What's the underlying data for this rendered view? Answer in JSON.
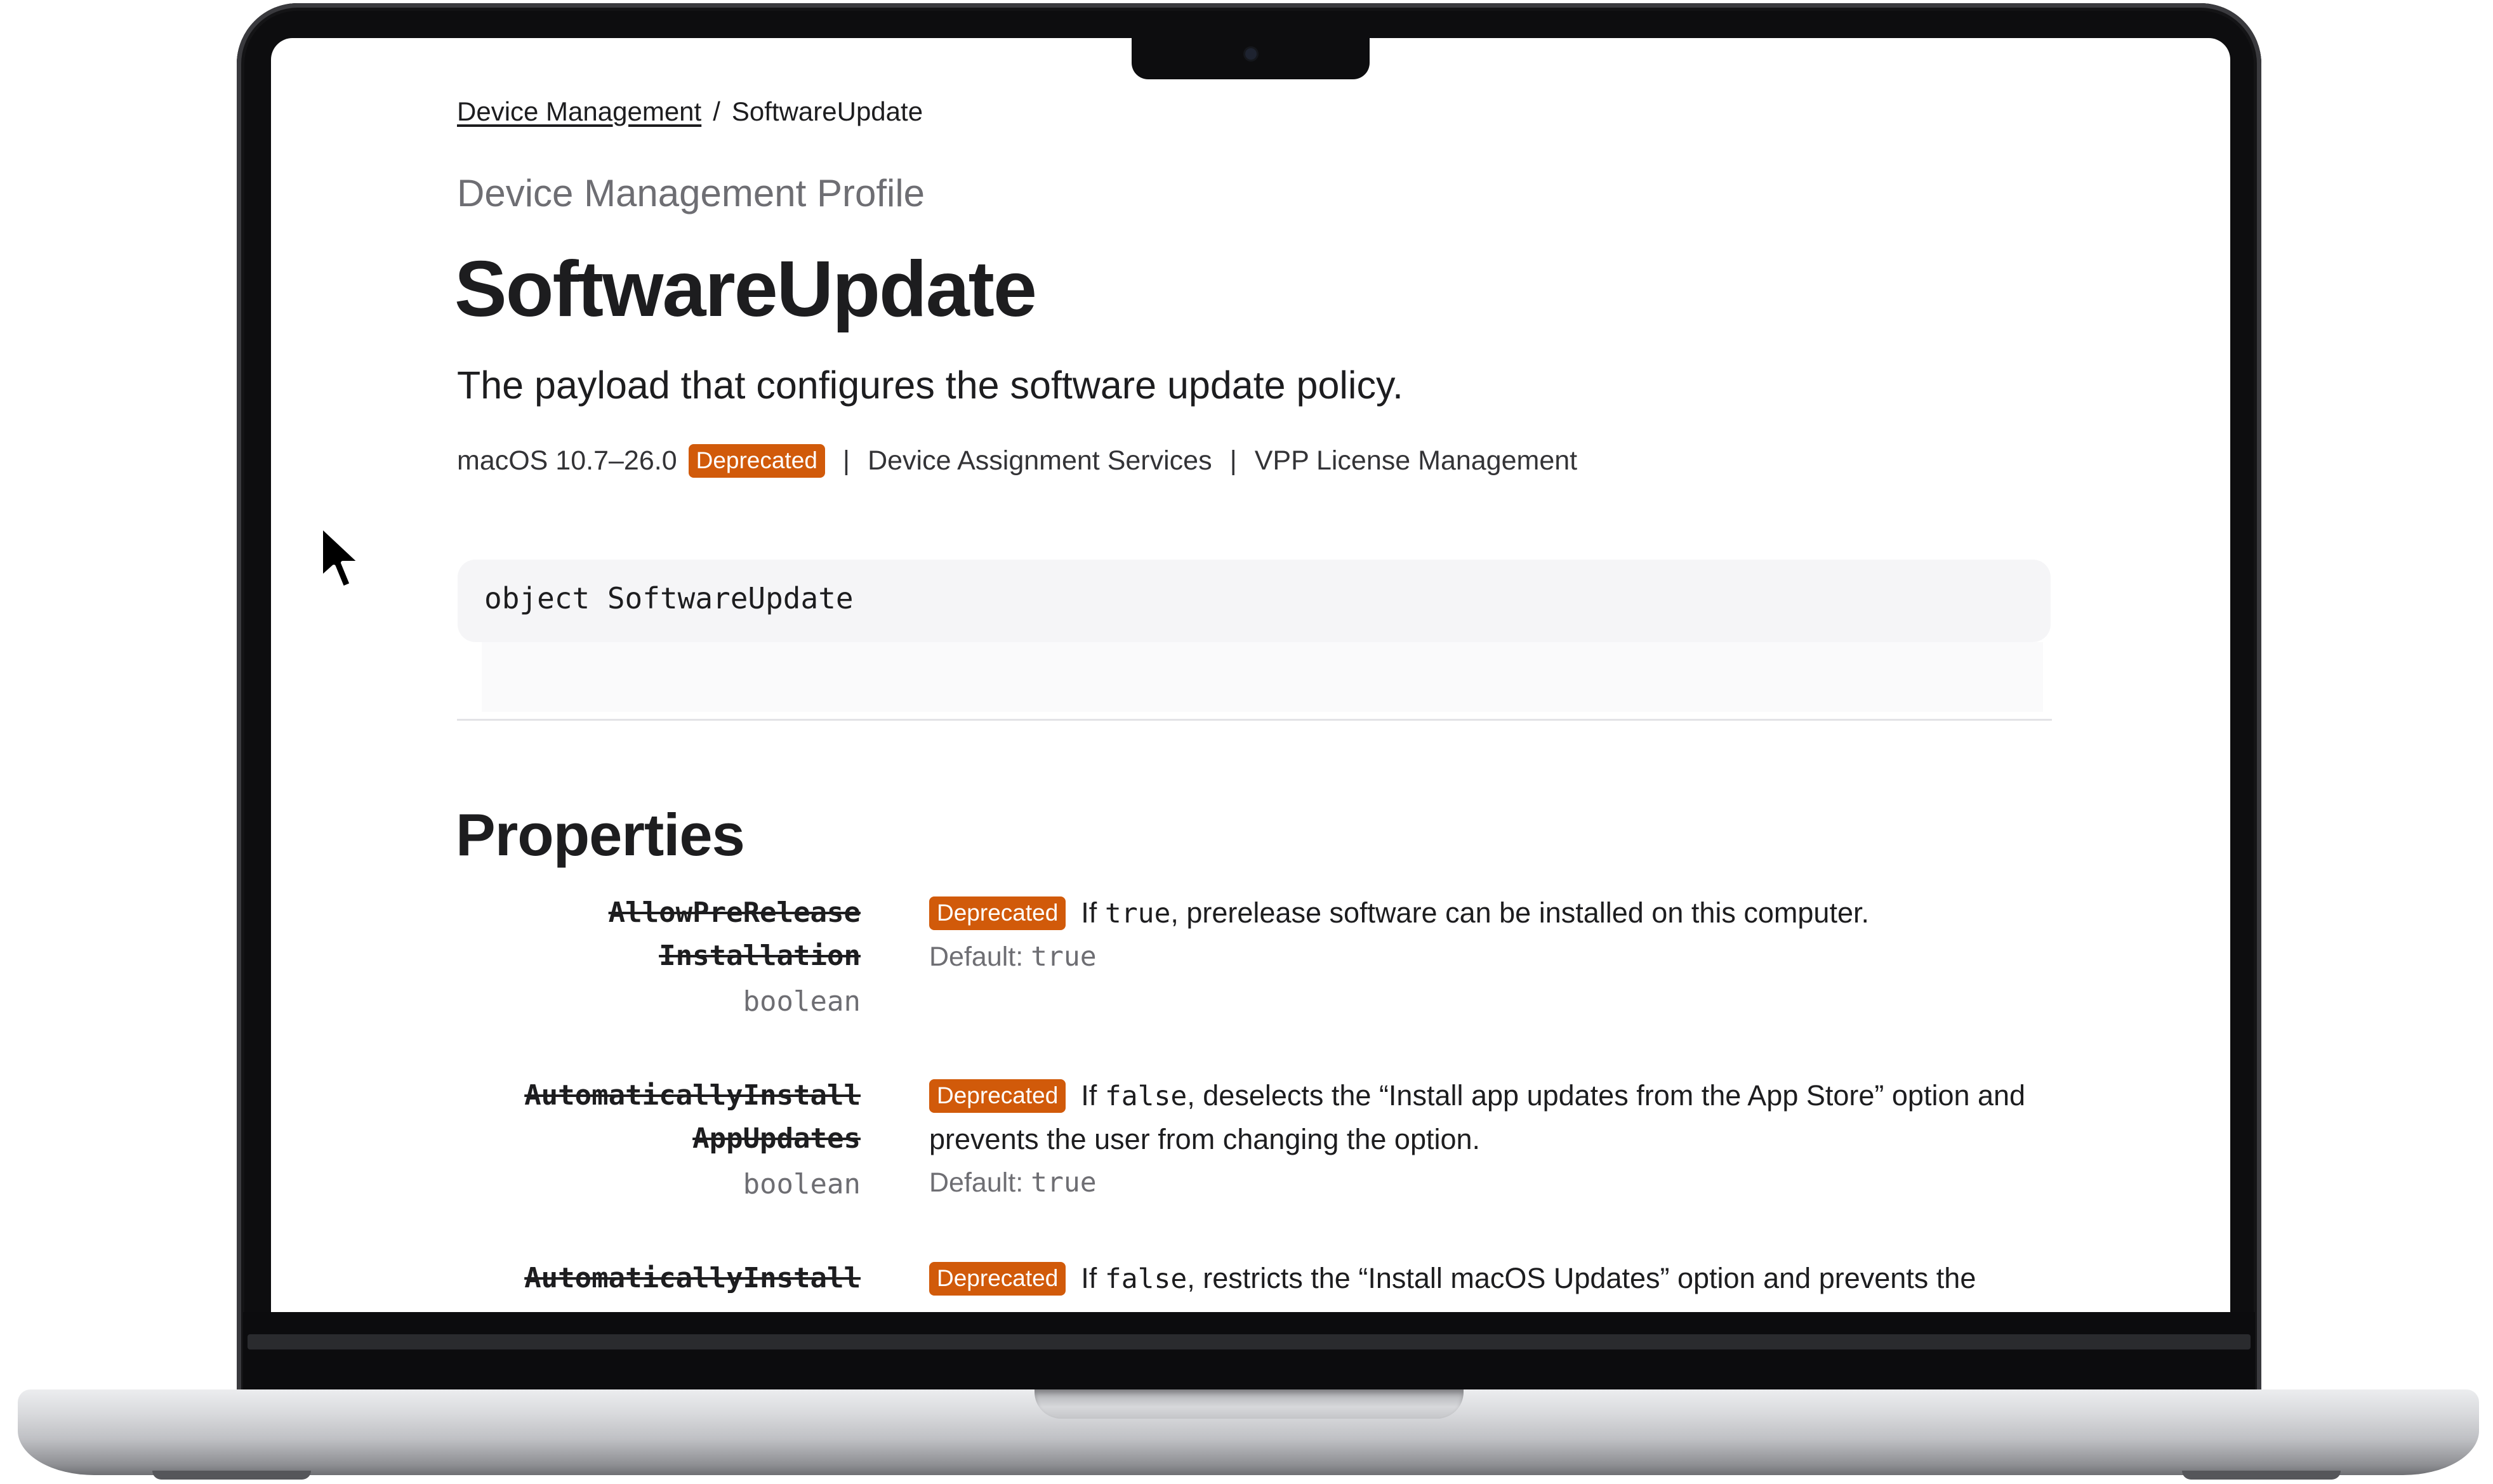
{
  "breadcrumb": {
    "parent": "Device Management",
    "separator": "/",
    "current": "SoftwareUpdate"
  },
  "eyebrow": "Device Management Profile",
  "title": "SoftwareUpdate",
  "abstract": "The payload that configures the software update policy.",
  "availability": {
    "platform": "macOS 10.7–26.0",
    "badge": "Deprecated",
    "separator": "|",
    "items": [
      "Device Assignment Services",
      "VPP License Management"
    ]
  },
  "declaration": "object SoftwareUpdate",
  "properties_section": {
    "title": "Properties",
    "items": [
      {
        "name_line1": "AllowPreRelease",
        "name_line2": "Installation",
        "type": "boolean",
        "badge": "Deprecated",
        "desc_pre": "If ",
        "desc_code": "true",
        "desc_post": ", prerelease software can be installed on this computer.",
        "default_label": "Default: ",
        "default_value": "true"
      },
      {
        "name_line1": "AutomaticallyInstall",
        "name_line2": "AppUpdates",
        "type": "boolean",
        "badge": "Deprecated",
        "desc_pre": "If ",
        "desc_code": "false",
        "desc_post": ", deselects the “Install app updates from the App Store” option and prevents the user from changing the option.",
        "default_label": "Default: ",
        "default_value": "true"
      },
      {
        "name_line1": "AutomaticallyInstall",
        "badge": "Deprecated",
        "desc_pre": "If ",
        "desc_code": "false",
        "desc_post": ", restricts the “Install macOS Updates” option and prevents the"
      }
    ]
  }
}
